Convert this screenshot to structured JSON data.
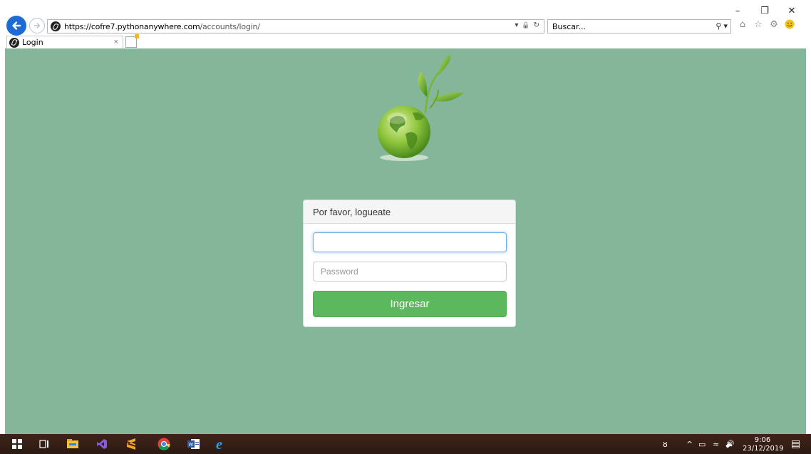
{
  "browser": {
    "url_domain": "https://cofre7.pythonanywhere.com",
    "url_path": "/accounts/login/",
    "search_placeholder": "Buscar...",
    "tab_label": "Login",
    "tab_close": "×",
    "window_controls": {
      "minimize": "–",
      "restore": "❐",
      "close": "✕"
    },
    "address_tools": {
      "dropdown": "▾",
      "lock": "🔒",
      "refresh": "↻"
    },
    "search_tools": {
      "search": "⚲",
      "dropdown": "▾"
    },
    "toolbar_icons": {
      "home": "⌂",
      "favorites": "☆",
      "settings": "⚙"
    }
  },
  "login": {
    "heading": "Por favor, logueate",
    "username_value": "",
    "password_placeholder": "Password",
    "submit_label": "Ingresar"
  },
  "taskbar": {
    "time": "9:06",
    "date": "23/12/2019",
    "tray": {
      "people": "ȣ",
      "chevron": "^",
      "battery": "▭",
      "wifi": "≈",
      "volume": "🔊",
      "notifications": "▤"
    }
  },
  "colors": {
    "page_background": "#84b69a",
    "submit_button": "#5cb85c",
    "taskbar": "#3a2117",
    "back_button": "#1c6bd6"
  }
}
